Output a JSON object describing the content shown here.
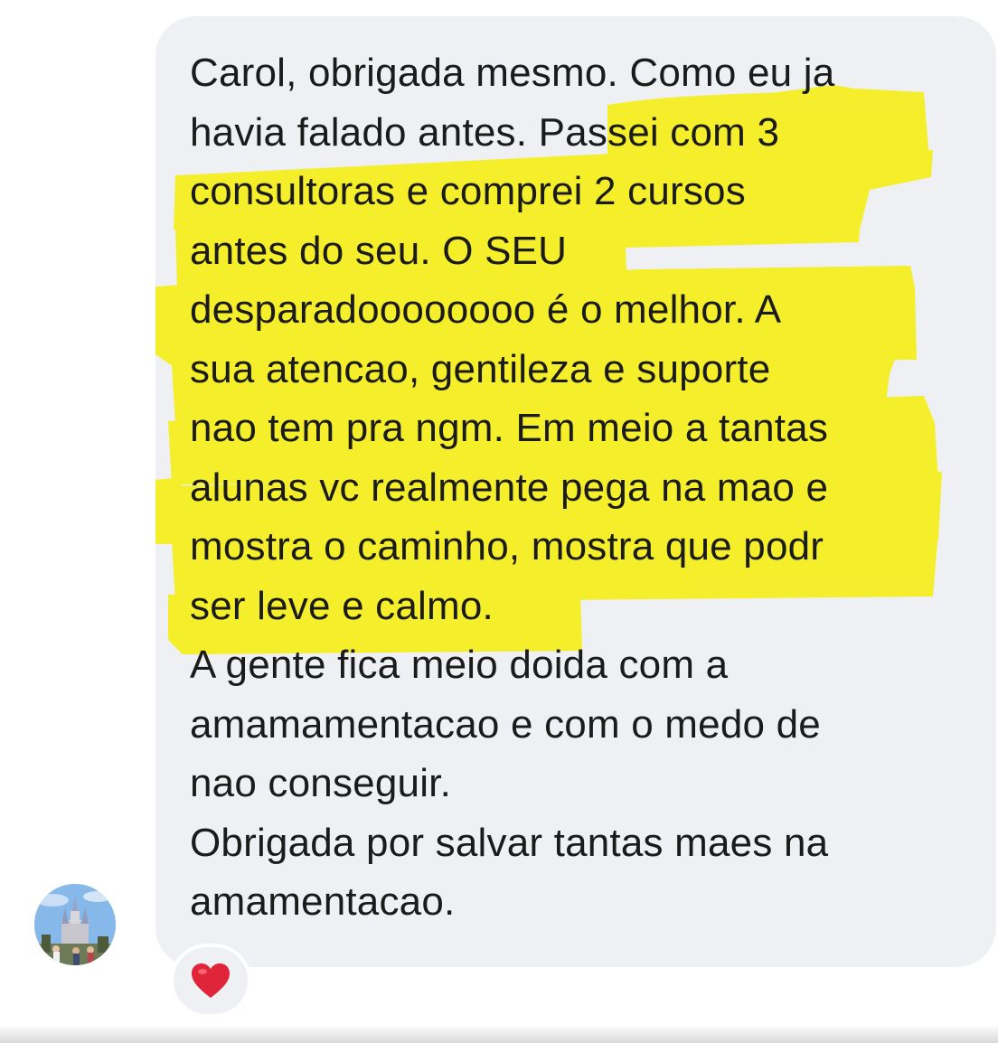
{
  "message": {
    "lines": [
      "Carol, obrigada mesmo. Como eu ja",
      "havia falado antes. Passei com 3",
      "consultoras e comprei 2 cursos",
      "antes do seu. O SEU",
      "desparadoooooooo é o melhor. A",
      "sua atencao, gentileza e suporte",
      "nao tem pra ngm. Em meio a tantas",
      "alunas vc realmente pega na mao e",
      "mostra o caminho, mostra que podr",
      "ser leve e calmo.",
      "A gente fica meio doida com a",
      "amamamentacao e com o medo de",
      "nao conseguir.",
      "Obrigada por salvar tantas maes na",
      "amamentacao."
    ]
  },
  "reaction": {
    "icon": "heart-icon",
    "color": "#e0243a"
  },
  "avatar": {
    "icon": "profile-photo-castle"
  },
  "colors": {
    "bubble": "#eef0f4",
    "highlight": "#f5ee1c",
    "text": "#1b1b1b"
  }
}
